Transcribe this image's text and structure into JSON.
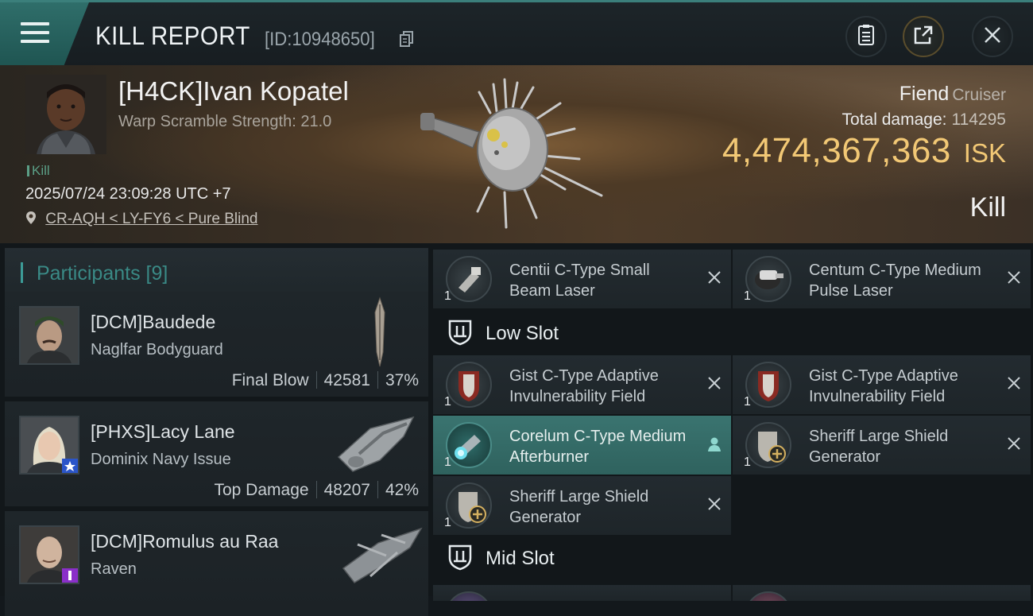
{
  "header": {
    "title": "KILL REPORT",
    "report_id": "[ID:10948650]"
  },
  "victim": {
    "name": "[H4CK]Ivan Kopatel",
    "warp_scramble": "Warp Scramble Strength: 21.0",
    "badge": "Kill",
    "timestamp": "2025/07/24 23:09:28 UTC +7",
    "location": "CR-AQH < LY-FY6 < Pure Blind",
    "ship_name": "Fiend",
    "ship_class": "Cruiser",
    "total_damage_label": "Total damage:",
    "total_damage": "114295",
    "isk_value": "4,474,367,363",
    "isk_unit": "ISK",
    "result": "Kill"
  },
  "participants": {
    "title": "Participants",
    "count": "[9]",
    "items": [
      {
        "name": "[DCM]Baudede",
        "ship": "Naglfar Bodyguard",
        "tag": "Final Blow",
        "damage": "42581",
        "percent": "37%"
      },
      {
        "name": "[PHXS]Lacy Lane",
        "ship": "Dominix Navy Issue",
        "tag": "Top Damage",
        "damage": "48207",
        "percent": "42%"
      },
      {
        "name": "[DCM]Romulus au Raa",
        "ship": "Raven"
      }
    ]
  },
  "fitting": {
    "high_slots": [
      {
        "name": "Centii C-Type Small Beam Laser",
        "qty": "1"
      },
      {
        "name": "Centum C-Type Medium Pulse Laser",
        "qty": "1"
      }
    ],
    "low_slot_label": "Low Slot",
    "low_slots": [
      {
        "name": "Gist C-Type Adaptive Invulnerability Field",
        "qty": "1"
      },
      {
        "name": "Gist C-Type Adaptive Invulnerability Field",
        "qty": "1"
      },
      {
        "name": "Corelum C-Type Medium Afterburner",
        "qty": "1"
      },
      {
        "name": "Sheriff Large Shield Generator",
        "qty": "1"
      },
      {
        "name": "Sheriff Large Shield Generator",
        "qty": "1"
      }
    ],
    "mid_slot_label": "Mid Slot"
  },
  "colors": {
    "accent_teal": "#3c9b97",
    "isk_gold": "#f2c875",
    "active_slot": "#3a7470"
  },
  "icons": [
    "menu-icon",
    "copy-icon",
    "clipboard-icon",
    "share-icon",
    "close-icon",
    "location-pin-icon",
    "shield-slot-icon",
    "pilot-icon",
    "remove-icon"
  ]
}
